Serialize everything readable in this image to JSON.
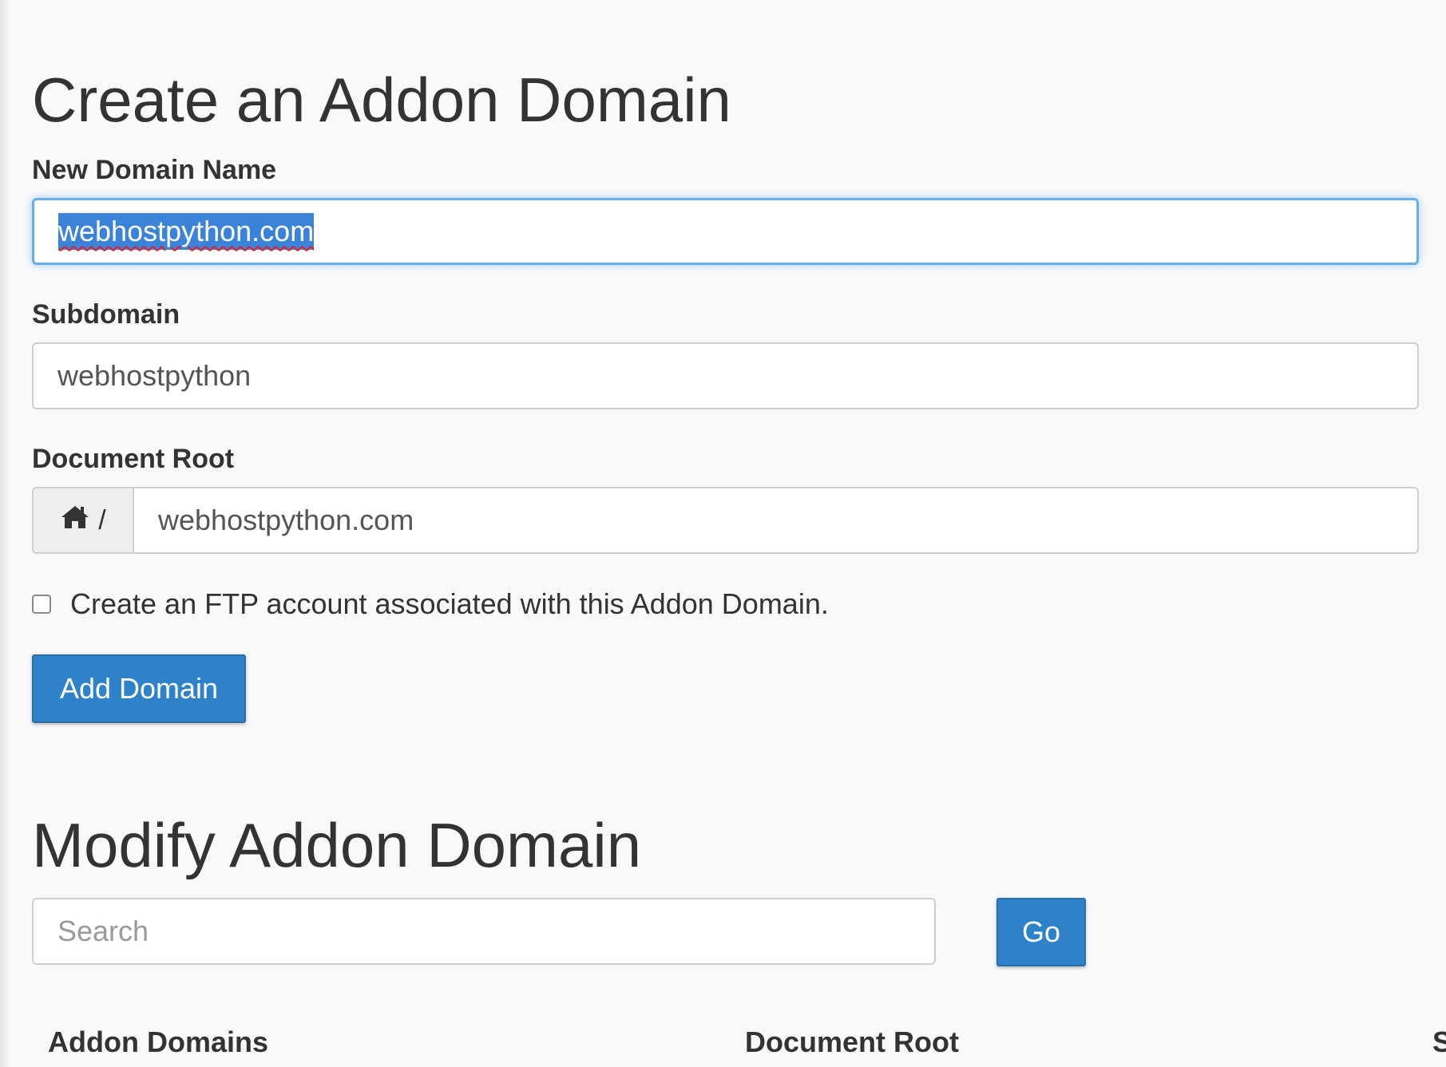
{
  "create": {
    "title": "Create an Addon Domain",
    "new_domain_label": "New Domain Name",
    "new_domain_value": "webhostpython.com",
    "subdomain_label": "Subdomain",
    "subdomain_value": "webhostpython",
    "document_root_label": "Document Root",
    "document_root_prefix_icon": "home-icon",
    "document_root_prefix_separator": "/",
    "document_root_value": "webhostpython.com",
    "ftp_checkbox_checked": false,
    "ftp_checkbox_label": "Create an FTP account associated with this Addon Domain.",
    "add_button_label": "Add Domain"
  },
  "modify": {
    "title": "Modify Addon Domain",
    "search_placeholder": "Search",
    "go_button_label": "Go",
    "columns": [
      "Addon Domains",
      "Document Root",
      "S"
    ]
  },
  "colors": {
    "primary_button": "#2e82c9",
    "focus_border": "#66afe9",
    "selection": "#3b83d8"
  }
}
